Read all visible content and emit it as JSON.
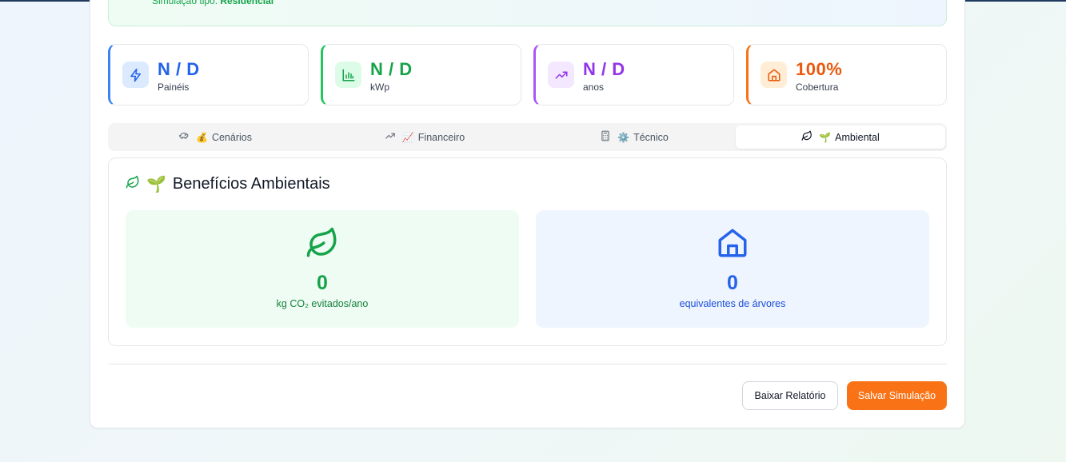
{
  "banner": {
    "prefix": "Simulação tipo: ",
    "value": "Residencial"
  },
  "stats": [
    {
      "value": "N / D",
      "label": "Painéis",
      "color": "#2563eb",
      "icon": "lightning-icon"
    },
    {
      "value": "N / D",
      "label": "kWp",
      "color": "#16a34a",
      "icon": "bar-chart-icon"
    },
    {
      "value": "N / D",
      "label": "anos",
      "color": "#9333ea",
      "icon": "trending-up-icon"
    },
    {
      "value": "100%",
      "label": "Cobertura",
      "color": "#ea580c",
      "icon": "home-icon"
    }
  ],
  "tabs": [
    {
      "emoji": "💰",
      "label": "Cenários",
      "icon": "piggy-bank-icon"
    },
    {
      "emoji": "📈",
      "label": "Financeiro",
      "icon": "trending-up-icon"
    },
    {
      "emoji": "⚙️",
      "label": "Técnico",
      "icon": "calculator-icon"
    },
    {
      "emoji": "🌱",
      "label": "Ambiental",
      "icon": "leaf-icon",
      "active": true
    }
  ],
  "panel": {
    "emoji": "🌱",
    "title": "Benefícios Ambientais",
    "co2": {
      "value": "0",
      "label": "kg CO₂ evitados/ano",
      "icon": "leaf-icon"
    },
    "trees": {
      "value": "0",
      "label": "equivalentes de árvores",
      "icon": "home-icon"
    }
  },
  "actions": {
    "download_label": "Baixar Relatório",
    "save_label": "Salvar Simulação"
  }
}
